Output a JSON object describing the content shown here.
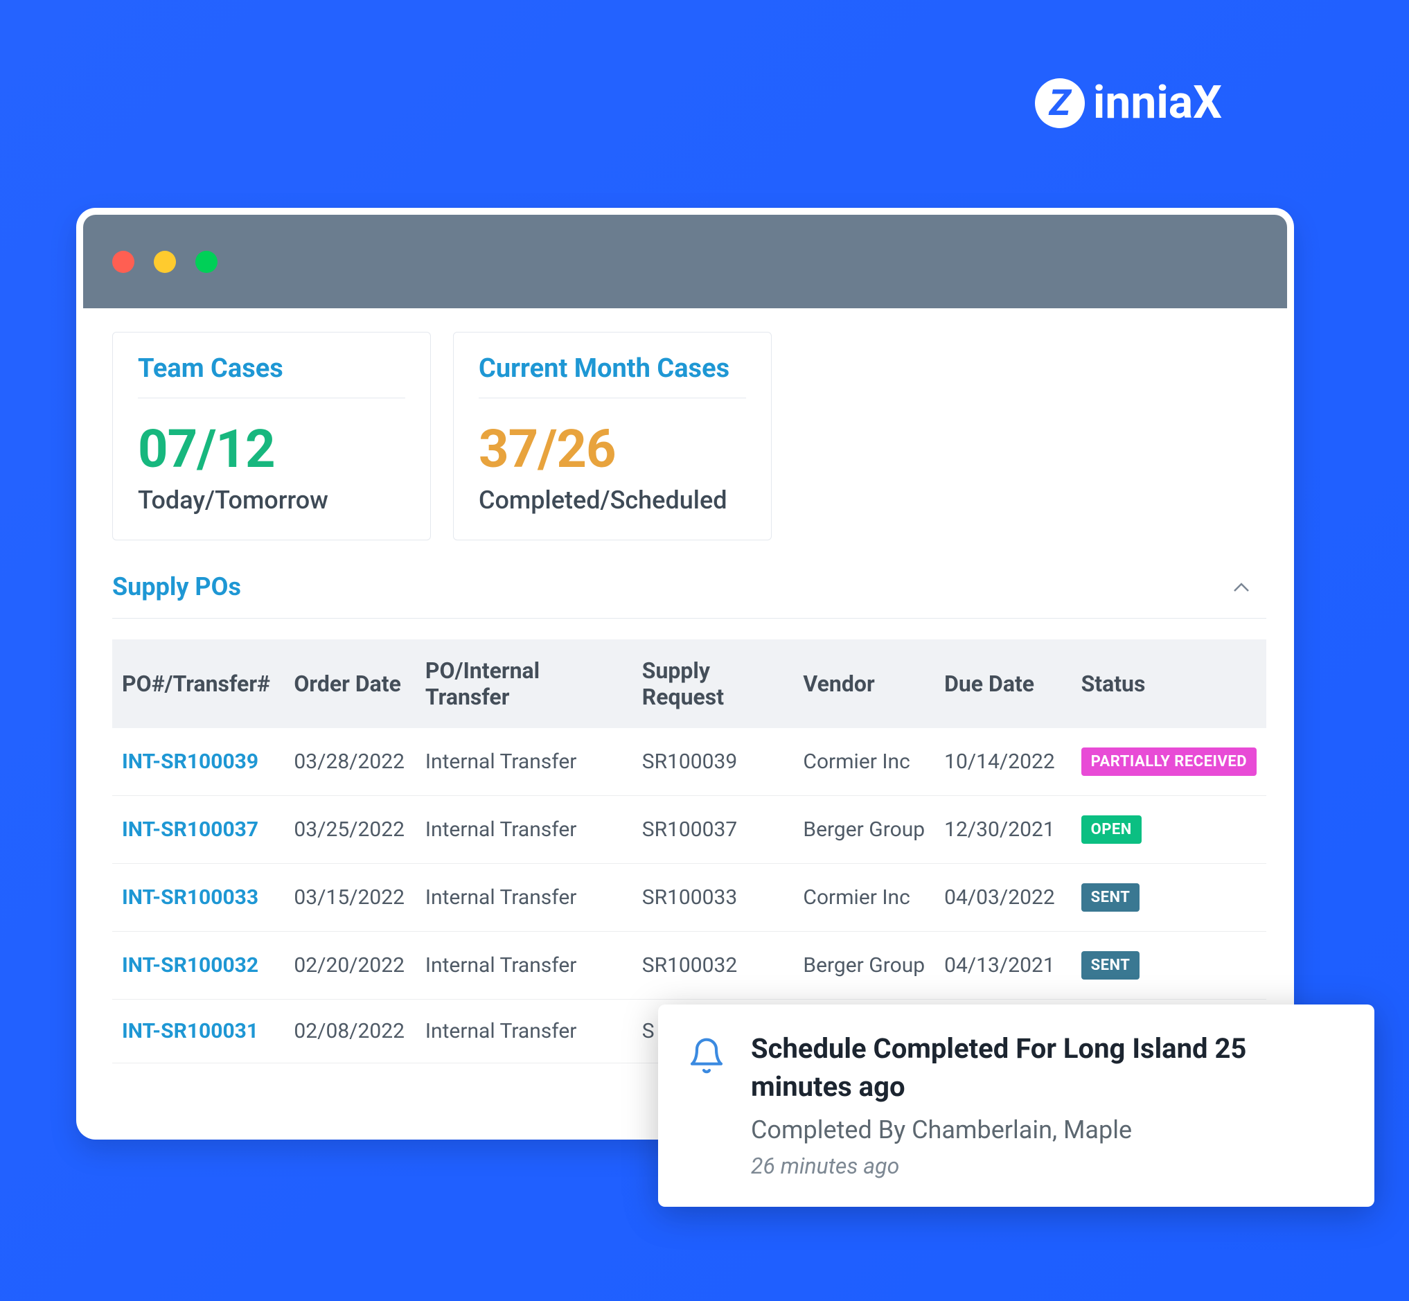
{
  "brand": {
    "mark": "Z",
    "name": "inniaX"
  },
  "stats": [
    {
      "title": "Team Cases",
      "value": "07/12",
      "sub": "Today/Tomorrow",
      "color": "stat-green"
    },
    {
      "title": "Current Month Cases",
      "value": "37/26",
      "sub": "Completed/Scheduled",
      "color": "stat-orange"
    }
  ],
  "section": {
    "title": "Supply POs"
  },
  "table": {
    "headers": [
      "PO#/Transfer#",
      "Order Date",
      "PO/Internal Transfer",
      "Supply Request",
      "Vendor",
      "Due Date",
      "Status"
    ],
    "rows": [
      {
        "po": "INT-SR100039",
        "order": "03/28/2022",
        "type": "Internal Transfer",
        "sr": "SR100039",
        "vendor": "Cormier Inc",
        "due": "10/14/2022",
        "status": "PARTIALLY RECEIVED",
        "badge": "badge-pink"
      },
      {
        "po": "INT-SR100037",
        "order": "03/25/2022",
        "type": "Internal Transfer",
        "sr": "SR100037",
        "vendor": "Berger Group",
        "due": "12/30/2021",
        "status": "OPEN",
        "badge": "badge-green"
      },
      {
        "po": "INT-SR100033",
        "order": "03/15/2022",
        "type": "Internal Transfer",
        "sr": "SR100033",
        "vendor": "Cormier Inc",
        "due": "04/03/2022",
        "status": "SENT",
        "badge": "badge-teal"
      },
      {
        "po": "INT-SR100032",
        "order": "02/20/2022",
        "type": "Internal Transfer",
        "sr": "SR100032",
        "vendor": "Berger Group",
        "due": "04/13/2021",
        "status": "SENT",
        "badge": "badge-teal"
      },
      {
        "po": "INT-SR100031",
        "order": "02/08/2022",
        "type": "Internal Transfer",
        "sr": "S",
        "vendor": "",
        "due": "",
        "status": "",
        "badge": ""
      }
    ]
  },
  "toast": {
    "title": "Schedule Completed For Long Island 25 minutes ago",
    "sub": "Completed By Chamberlain, Maple",
    "time": "26 minutes ago"
  }
}
